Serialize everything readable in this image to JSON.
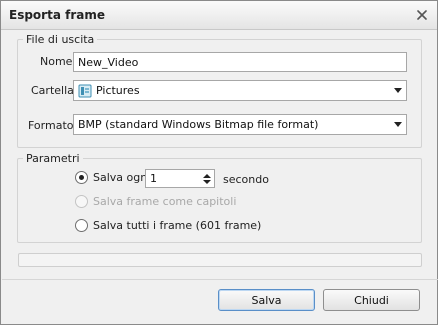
{
  "window": {
    "title": "Esporta frame"
  },
  "output": {
    "group_title": "File di uscita",
    "name_label": "Nome",
    "name_value": "New_Video",
    "folder_label": "Cartella",
    "folder_value": "Pictures",
    "folder_icon": "pictures-folder-icon",
    "format_label": "Formato",
    "format_value": "BMP (standard Windows Bitmap file format)"
  },
  "params": {
    "group_title": "Parametri",
    "save_every_label": "Salva ogni",
    "save_every_value": "1",
    "save_every_unit": "secondo",
    "save_every_selected": true,
    "save_as_chapters_label": "Salva frame come capitoli",
    "save_as_chapters_enabled": false,
    "save_all_label": "Salva tutti i frame (601 frame)"
  },
  "progress": {
    "value_percent": 0
  },
  "buttons": {
    "save_label": "Salva",
    "close_label": "Chiudi"
  },
  "colors": {
    "accent": "#5a8fc8",
    "progress_fill": "#7fb0e6"
  }
}
